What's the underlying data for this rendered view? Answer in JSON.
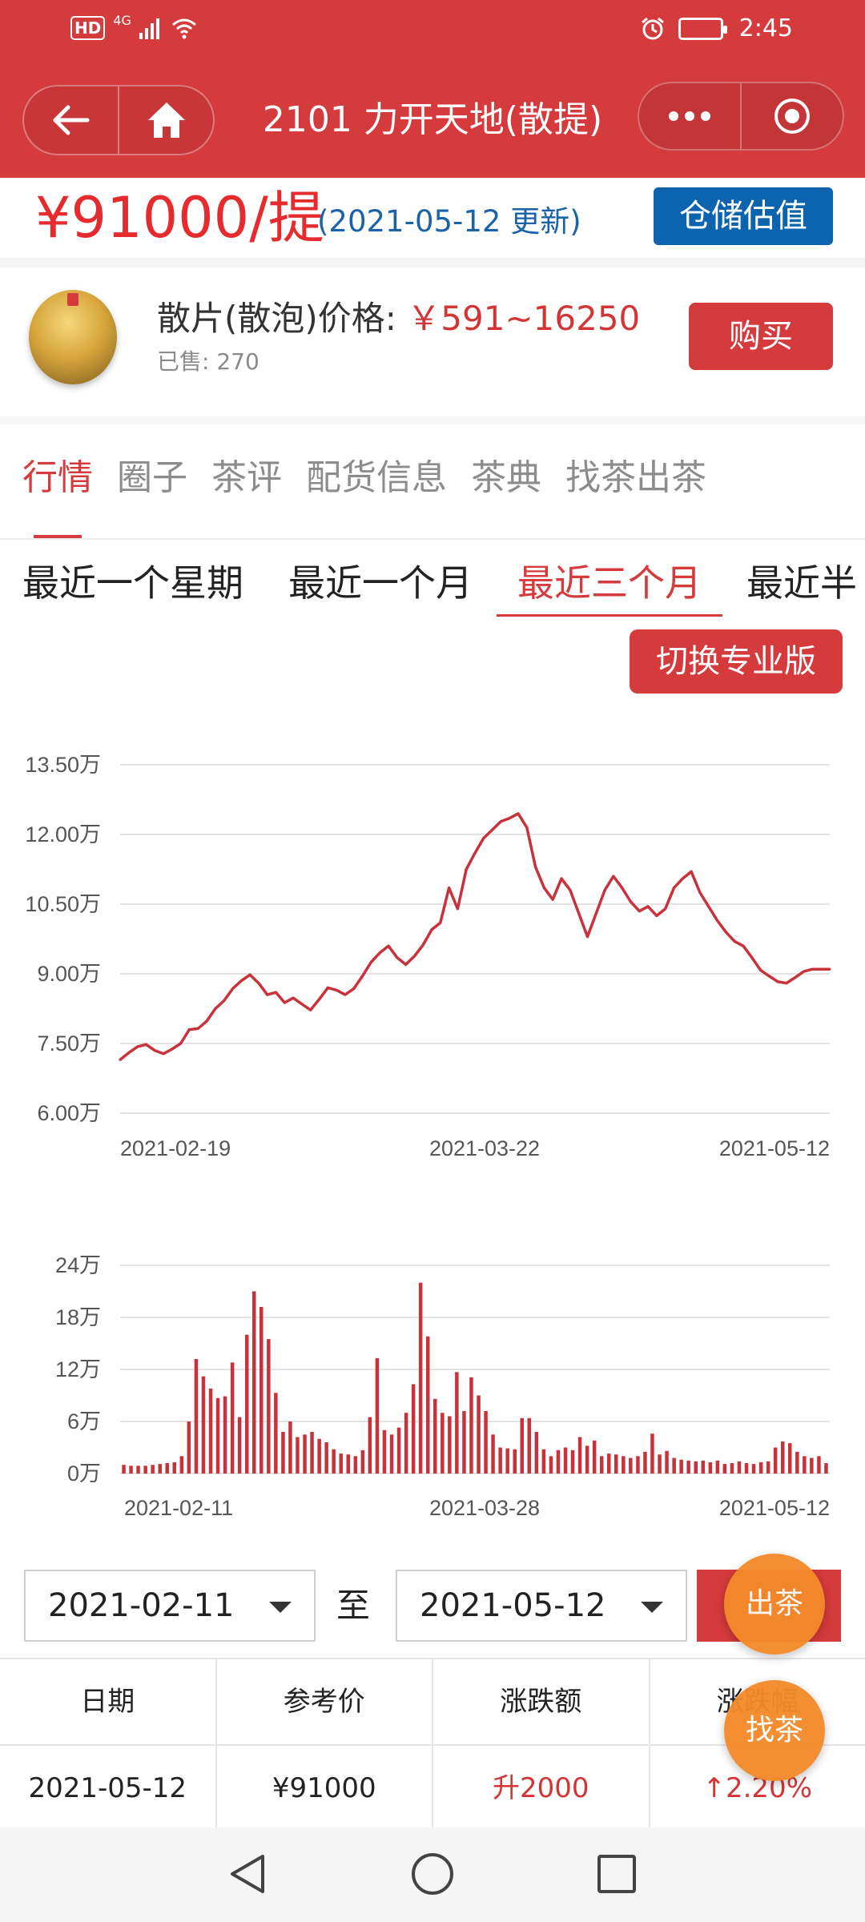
{
  "status_bar": {
    "hd": "HD",
    "network": "4G",
    "time": "2:45"
  },
  "header": {
    "title": "2101 力开天地(散提)"
  },
  "price_bar": {
    "price": "¥91000/提",
    "update_note": "(2021-05-12 更新)",
    "valuation_button": "仓储估值"
  },
  "product": {
    "price_label": "散片(散泡)价格:",
    "price_range": "￥591~16250",
    "sold": "已售: 270",
    "buy_button": "购买"
  },
  "tabs": [
    "行情",
    "圈子",
    "茶评",
    "配货信息",
    "茶典",
    "找茶出茶"
  ],
  "active_tab": "行情",
  "ranges": [
    "最近一个星期",
    "最近一个月",
    "最近三个月",
    "最近半"
  ],
  "active_range": "最近三个月",
  "switch_button": "切换专业版",
  "date_filter": {
    "from": "2021-02-11",
    "separator": "至",
    "to": "2021-05-12"
  },
  "table": {
    "headers": [
      "日期",
      "参考价",
      "涨跌额",
      "涨跌幅"
    ],
    "rows": [
      [
        "2021-05-12",
        "¥91000",
        "升2000",
        "↑2.20%"
      ]
    ]
  },
  "fabs": {
    "sell_tea": "出茶",
    "find_tea": "找茶"
  },
  "colors": {
    "brand_red": "#d53a3c",
    "price_red": "#e62b2f",
    "link_blue": "#1a63a8",
    "button_blue": "#0b64ad",
    "fab_orange": "#f38b2a"
  },
  "icons": {
    "back": "arrow-left-icon",
    "home": "home-icon",
    "more": "more-dots-icon",
    "close": "target-circle-icon"
  },
  "chart_data": [
    {
      "type": "line",
      "title": "",
      "xlabel": "",
      "ylabel": "",
      "y_tick_labels": [
        "13.50万",
        "12.00万",
        "10.50万",
        "9.00万",
        "7.50万",
        "6.00万"
      ],
      "y_ticks": [
        135000,
        120000,
        105000,
        90000,
        75000,
        60000
      ],
      "x_tick_labels": [
        "2021-02-19",
        "2021-03-22",
        "2021-05-12"
      ],
      "ylim": [
        60000,
        135000
      ],
      "grid": true,
      "color": "#c8323a",
      "x": [
        "2021-02-19",
        "2021-02-20",
        "2021-02-21",
        "2021-02-22",
        "2021-02-23",
        "2021-02-24",
        "2021-02-25",
        "2021-02-26",
        "2021-02-27",
        "2021-02-28",
        "2021-03-01",
        "2021-03-02",
        "2021-03-03",
        "2021-03-04",
        "2021-03-05",
        "2021-03-06",
        "2021-03-07",
        "2021-03-08",
        "2021-03-09",
        "2021-03-10",
        "2021-03-11",
        "2021-03-12",
        "2021-03-13",
        "2021-03-14",
        "2021-03-15",
        "2021-03-16",
        "2021-03-17",
        "2021-03-18",
        "2021-03-19",
        "2021-03-20",
        "2021-03-21",
        "2021-03-22",
        "2021-03-23",
        "2021-03-24",
        "2021-03-25",
        "2021-03-26",
        "2021-03-27",
        "2021-03-28",
        "2021-03-29",
        "2021-03-30",
        "2021-03-31",
        "2021-04-01",
        "2021-04-02",
        "2021-04-03",
        "2021-04-04",
        "2021-04-05",
        "2021-04-06",
        "2021-04-07",
        "2021-04-08",
        "2021-04-09",
        "2021-04-10",
        "2021-04-11",
        "2021-04-12",
        "2021-04-13",
        "2021-04-14",
        "2021-04-15",
        "2021-04-16",
        "2021-04-17",
        "2021-04-18",
        "2021-04-19",
        "2021-04-20",
        "2021-04-21",
        "2021-04-22",
        "2021-04-23",
        "2021-04-24",
        "2021-04-25",
        "2021-04-26",
        "2021-04-27",
        "2021-04-28",
        "2021-04-29",
        "2021-04-30",
        "2021-05-01",
        "2021-05-02",
        "2021-05-03",
        "2021-05-04",
        "2021-05-05",
        "2021-05-06",
        "2021-05-07",
        "2021-05-08",
        "2021-05-09",
        "2021-05-10",
        "2021-05-11",
        "2021-05-12"
      ],
      "values": [
        71500,
        73000,
        74300,
        74800,
        73500,
        72800,
        73800,
        75000,
        78000,
        78200,
        79800,
        82500,
        84200,
        86800,
        88500,
        89800,
        88000,
        85500,
        86000,
        83800,
        84800,
        83500,
        82200,
        84500,
        87000,
        86500,
        85500,
        86800,
        89500,
        92500,
        94500,
        96000,
        93500,
        92000,
        93800,
        96200,
        99500,
        101000,
        108500,
        104000,
        112500,
        116000,
        119200,
        121000,
        122800,
        123500,
        124500,
        121500,
        113000,
        108500,
        106000,
        110500,
        108000,
        103000,
        98000,
        103000,
        108000,
        111000,
        108500,
        105500,
        103500,
        104500,
        102500,
        104000,
        108500,
        110500,
        112000,
        107500,
        104500,
        101500,
        99000,
        97000,
        96000,
        93500,
        90800,
        89500,
        88300,
        88000,
        89200,
        90500,
        91000,
        91000,
        91000
      ]
    },
    {
      "type": "bar",
      "title": "",
      "xlabel": "",
      "ylabel": "",
      "y_tick_labels": [
        "24万",
        "18万",
        "12万",
        "6万",
        "0万"
      ],
      "y_ticks": [
        240000,
        180000,
        120000,
        60000,
        0
      ],
      "x_tick_labels": [
        "2021-02-11",
        "2021-03-28",
        "2021-05-12"
      ],
      "ylim": [
        0,
        240000
      ],
      "grid": true,
      "color": "#c8323a",
      "values": [
        10000,
        9000,
        9000,
        9000,
        10000,
        11000,
        12000,
        13000,
        20000,
        60000,
        132000,
        112000,
        98000,
        87000,
        89000,
        128000,
        65000,
        160000,
        210000,
        192000,
        155000,
        93000,
        48000,
        60000,
        42000,
        45000,
        48000,
        40000,
        36000,
        28000,
        23000,
        22000,
        20000,
        27000,
        65000,
        133000,
        50000,
        45000,
        53000,
        70000,
        103000,
        220000,
        158000,
        86000,
        70000,
        66000,
        117000,
        72000,
        111000,
        90000,
        72000,
        45000,
        30000,
        29000,
        28000,
        64000,
        64000,
        48000,
        28000,
        20000,
        27000,
        30000,
        27000,
        42000,
        32000,
        38000,
        20000,
        23000,
        22000,
        20000,
        18000,
        20000,
        25000,
        46000,
        22000,
        26000,
        18000,
        16000,
        15000,
        14000,
        15000,
        13000,
        15000,
        11000,
        12000,
        14000,
        12000,
        11000,
        13000,
        14000,
        30000,
        37000,
        35000,
        25000,
        20000,
        18000,
        20000,
        12000
      ]
    }
  ]
}
